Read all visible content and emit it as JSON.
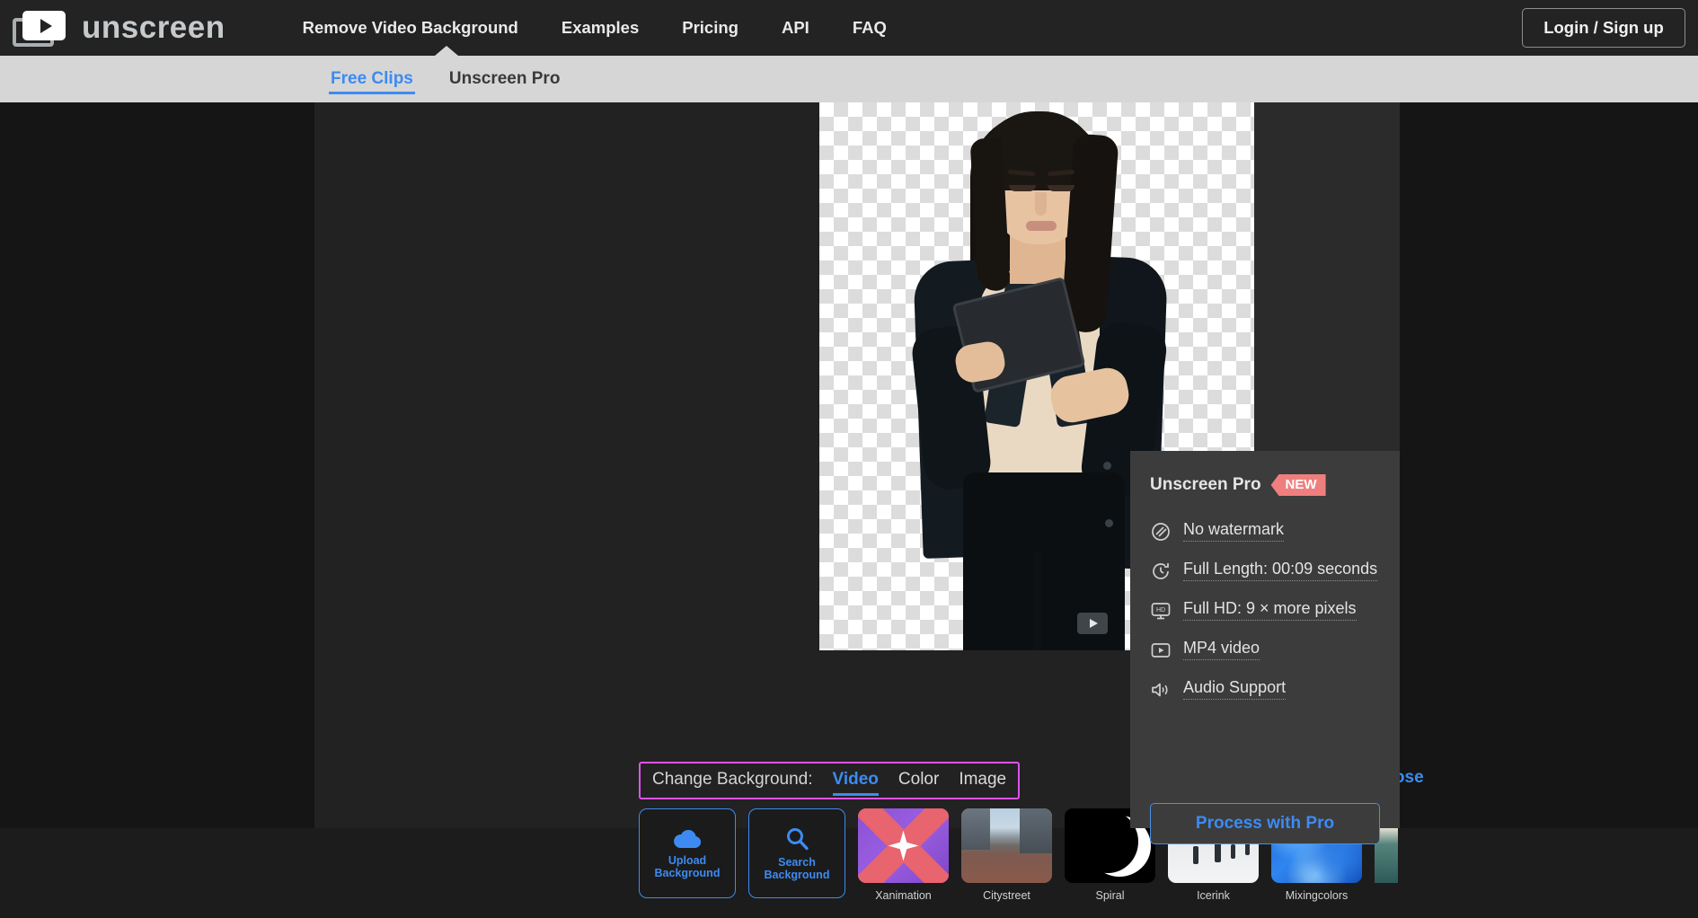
{
  "brand": {
    "name": "unscreen",
    "logo_icon": "video-frames-play-icon"
  },
  "topnav": {
    "links": [
      {
        "label": "Remove Video Background",
        "name": "nav-remove-video-background"
      },
      {
        "label": "Examples",
        "name": "nav-examples"
      },
      {
        "label": "Pricing",
        "name": "nav-pricing"
      },
      {
        "label": "API",
        "name": "nav-api"
      },
      {
        "label": "FAQ",
        "name": "nav-faq"
      }
    ],
    "login_label": "Login / Sign up"
  },
  "subtabs": {
    "free_clips": "Free Clips",
    "unscreen_pro": "Unscreen Pro",
    "active": "Free Clips",
    "active_color": "#3d8bf2"
  },
  "editor": {
    "change_background_label": "Change Background:",
    "modes": [
      {
        "label": "Video",
        "name": "bg-mode-video",
        "active": true
      },
      {
        "label": "Color",
        "name": "bg-mode-color",
        "active": false
      },
      {
        "label": "Image",
        "name": "bg-mode-image",
        "active": false
      }
    ],
    "close_label": "Close",
    "close_icon": "close-x-icon",
    "highlight_color": "#e052ed",
    "actions": [
      {
        "line1": "Upload",
        "line2": "Background",
        "icon": "cloud-upload-icon",
        "name": "upload-background-tile"
      },
      {
        "line1": "Search",
        "line2": "Background",
        "icon": "search-icon",
        "name": "search-background-tile"
      }
    ],
    "thumbnails": [
      {
        "label": "Xanimation",
        "art": "art-xanimation"
      },
      {
        "label": "Citystreet",
        "art": "art-citystreet"
      },
      {
        "label": "Spiral",
        "art": "art-spiral"
      },
      {
        "label": "Icerink",
        "art": "art-icerink"
      },
      {
        "label": "Mixingcolors",
        "art": "art-mixingcolors"
      },
      {
        "label": "",
        "art": "art-ocean"
      }
    ]
  },
  "pro_panel": {
    "title": "Unscreen Pro",
    "badge": "NEW",
    "badge_color": "#ef7f7f",
    "features": [
      {
        "label": "No watermark",
        "icon": "no-watermark-icon"
      },
      {
        "label": "Full Length: 00:09 seconds",
        "icon": "clock-refresh-icon"
      },
      {
        "label": "Full HD: 9 × more pixels",
        "icon": "hd-monitor-icon"
      },
      {
        "label": "MP4 video",
        "icon": "video-play-icon"
      },
      {
        "label": "Audio Support",
        "icon": "speaker-waves-icon"
      }
    ],
    "process_label": "Process with Pro"
  }
}
